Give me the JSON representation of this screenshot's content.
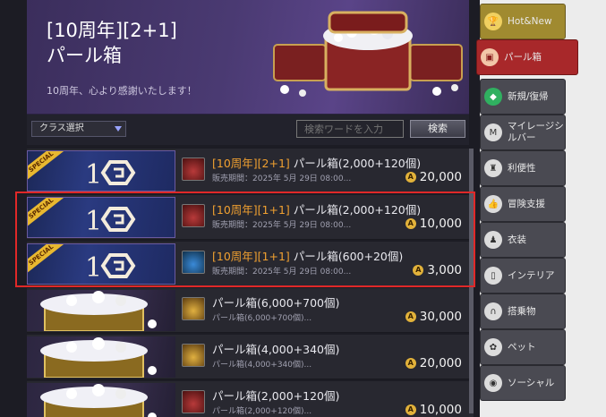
{
  "banner": {
    "title_line1": "[10周年][2+1]",
    "title_line2": "パール箱",
    "subtitle": "10周年、心より感謝いたします！"
  },
  "filter": {
    "class_select": "クラス選択",
    "search_placeholder": "検索ワードを入力",
    "search_button": "検索"
  },
  "items": [
    {
      "prefix": "[10周年][2+1]",
      "name": " パール箱(2,000+120個)",
      "period": "販売期間：2025年 5月 29日 08:00...",
      "price": "20,000",
      "thumb": "special",
      "icon": "red"
    },
    {
      "prefix": "[10周年][1+1]",
      "name": " パール箱(2,000+120個)",
      "period": "販売期間：2025年 5月 29日 08:00...",
      "price": "10,000",
      "thumb": "special",
      "icon": "red"
    },
    {
      "prefix": "[10周年][1+1]",
      "name": " パール箱(600+20個)",
      "period": "販売期間：2025年 5月 29日 08:00...",
      "price": "3,000",
      "thumb": "special",
      "icon": "blue"
    },
    {
      "prefix": "",
      "name": "パール箱(6,000+700個)",
      "period": "パール箱(6,000+700個)...",
      "price": "30,000",
      "thumb": "pearl",
      "icon": "gold"
    },
    {
      "prefix": "",
      "name": "パール箱(4,000+340個)",
      "period": "パール箱(4,000+340個)...",
      "price": "20,000",
      "thumb": "pearl",
      "icon": "gold"
    },
    {
      "prefix": "",
      "name": "パール箱(2,000+120個)",
      "period": "パール箱(2,000+120個)...",
      "price": "10,000",
      "thumb": "pearl",
      "icon": "red"
    }
  ],
  "special_label": "SPECIAL",
  "coin_symbol": "A",
  "tabs": [
    {
      "label": "Hot&New",
      "icon": "trophy-icon",
      "glyph": "🏆"
    },
    {
      "label": "パール箱",
      "icon": "chest-icon",
      "glyph": "▣"
    },
    {
      "label": "新規/復帰",
      "icon": "diamond-icon",
      "glyph": "◆"
    },
    {
      "label": "マイレージシルバー",
      "icon": "mileage-icon",
      "glyph": "M"
    },
    {
      "label": "利便性",
      "icon": "flask-icon",
      "glyph": "♜"
    },
    {
      "label": "冒険支援",
      "icon": "thumbs-up-icon",
      "glyph": "👍"
    },
    {
      "label": "衣装",
      "icon": "outfit-icon",
      "glyph": "♟"
    },
    {
      "label": "インテリア",
      "icon": "door-icon",
      "glyph": "▯"
    },
    {
      "label": "搭乗物",
      "icon": "horseshoe-icon",
      "glyph": "∩"
    },
    {
      "label": "ペット",
      "icon": "paw-icon",
      "glyph": "✿"
    },
    {
      "label": "ソーシャル",
      "icon": "social-icon",
      "glyph": "◉"
    }
  ],
  "colors": {
    "active_tab": "#a8282a",
    "hot_tab": "#a08a30",
    "highlight": "#e02828",
    "accent_text": "#f0a030"
  }
}
